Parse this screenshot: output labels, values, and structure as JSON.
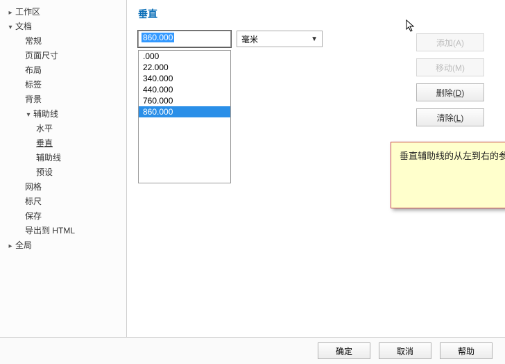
{
  "sidebar": {
    "items": [
      {
        "label": "工作区",
        "expandable": true,
        "expanded": false,
        "level": 0
      },
      {
        "label": "文档",
        "expandable": true,
        "expanded": true,
        "level": 0
      },
      {
        "label": "常规",
        "level": 2
      },
      {
        "label": "页面尺寸",
        "level": 2
      },
      {
        "label": "布局",
        "level": 2
      },
      {
        "label": "标签",
        "level": 2
      },
      {
        "label": "背景",
        "level": 2
      },
      {
        "label": "辅助线",
        "expandable": true,
        "expanded": true,
        "level": 2
      },
      {
        "label": "水平",
        "level": 3
      },
      {
        "label": "垂直",
        "level": 3,
        "selected": true
      },
      {
        "label": "辅助线",
        "level": 3
      },
      {
        "label": "预设",
        "level": 3
      },
      {
        "label": "网格",
        "level": 2
      },
      {
        "label": "标尺",
        "level": 2
      },
      {
        "label": "保存",
        "level": 2
      },
      {
        "label": "导出到 HTML",
        "level": 2
      },
      {
        "label": "全局",
        "expandable": true,
        "expanded": false,
        "level": 0
      }
    ]
  },
  "content": {
    "title": "垂直",
    "input_value": "860.000",
    "unit_selected": "毫米",
    "list": [
      ".000",
      "22.000",
      "340.000",
      "440.000",
      "760.000",
      "860.000"
    ],
    "list_selected": "860.000"
  },
  "buttons": {
    "add": "添加(A)",
    "move": "移动(M)",
    "delete": "删除",
    "delete_key": "D",
    "clear": "清除",
    "clear_key": "L"
  },
  "note": "垂直辅助线的从左到右的参数如图。",
  "footer": {
    "ok": "确定",
    "cancel": "取消",
    "help": "帮助"
  }
}
